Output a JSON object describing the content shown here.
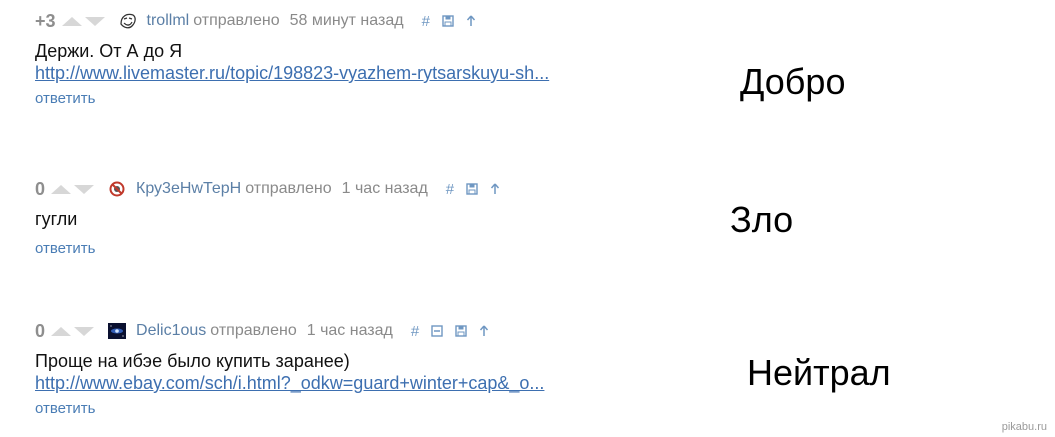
{
  "comments": [
    {
      "rating": "+3",
      "author": "trollml",
      "sent_label": "отправлено",
      "time": "58 минут назад",
      "actions": [
        "#"
      ],
      "text": "Держи. От А до Я",
      "link": "http://www.livemaster.ru/topic/198823-vyazhem-rytsarskuyu-sh...",
      "reply": "ответить",
      "avatar_icon": "troll-face-avatar"
    },
    {
      "rating": "0",
      "author": "Кру3еНwТерН",
      "sent_label": "отправлено",
      "time": "1 час назад",
      "actions": [
        "#"
      ],
      "text": "гугли",
      "reply": "ответить",
      "avatar_icon": "no-sign-avatar"
    },
    {
      "rating": "0",
      "author": "Delic1ous",
      "sent_label": "отправлено",
      "time": "1 час назад",
      "actions": [
        "#"
      ],
      "text": "Проще на ибэе было купить заранее)",
      "link": "http://www.ebay.com/sch/i.html?_odkw=guard+winter+cap&_o...",
      "reply": "ответить",
      "avatar_icon": "galaxy-avatar"
    }
  ],
  "labels": [
    "Добро",
    "Зло",
    "Нейтрал"
  ],
  "watermark": "pikabu.ru",
  "colors": {
    "author": "#5b7fa6",
    "link": "#3d6fb0",
    "meta_gray": "#8a8a8a",
    "vote_arrow": "#d7d7d7"
  }
}
